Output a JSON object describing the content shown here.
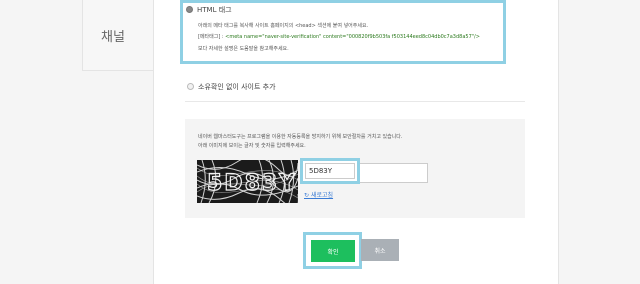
{
  "section": {
    "label": "채널"
  },
  "html_tag_option": {
    "label": "HTML 태그",
    "desc1": "아래의 메타 태그를 복사해 사이트 홈페이지의 <head> 섹션에 붙여 넣어주세요.",
    "meta_prefix": "[메타태그] : ",
    "meta_tag": "<meta name=\"naver-site-verification\" content=\"000820f9b503fa f503144eed8c04db0c7a3d8a57\"/>",
    "desc3": "보다 자세한 설명은 도움말을 참고해주세요."
  },
  "no_owner_option": {
    "label": "소유확인 없이 사이트 추가"
  },
  "captcha": {
    "notice1": "네이버 웹마스터도구는 프로그램을 이용한 자동등록을 방지하기 위해 보안절차를 거치고 있습니다.",
    "notice2": "아래 이미지에 보이는 글자 및 숫자를 입력해주세요.",
    "image_text": "5D83Y",
    "input_value": "5D83Y",
    "refresh_label": "새로고침"
  },
  "buttons": {
    "confirm": "확인",
    "cancel": "취소"
  }
}
